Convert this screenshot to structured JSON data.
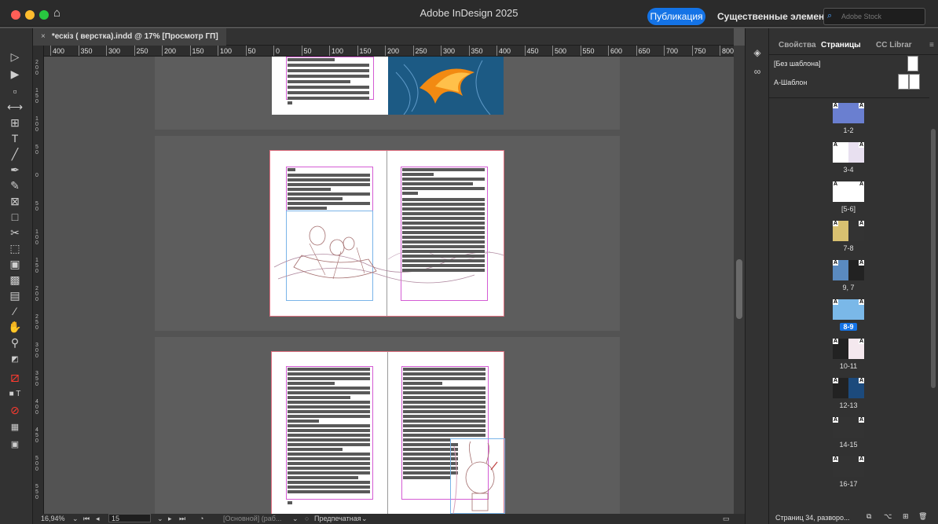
{
  "window": {
    "app_title": "Adobe InDesign 2025"
  },
  "header": {
    "publish_label": "Публикация",
    "workspace_label": "Существенные элементы",
    "stock_placeholder": "Adobe Stock"
  },
  "document_tab": {
    "close_glyph": "×",
    "title": "*ескіз ( верстка).indd @ 17% [Просмотр ГП]"
  },
  "hruler": {
    "labels": [
      "400",
      "350",
      "300",
      "250",
      "200",
      "150",
      "100",
      "50",
      "0",
      "50",
      "100",
      "150",
      "200",
      "250",
      "300",
      "350",
      "400",
      "450",
      "500",
      "550",
      "600",
      "650",
      "700",
      "750",
      "800"
    ]
  },
  "vruler": {
    "labels": [
      "200",
      "150",
      "100",
      "50",
      "0",
      "50",
      "100",
      "150",
      "200",
      "250",
      "300",
      "350",
      "400",
      "450",
      "500",
      "550"
    ]
  },
  "status": {
    "zoom": "16,94%",
    "page_number": "15",
    "master": "[Основной] (раб...",
    "preflight": "Предпечатная"
  },
  "right_panel": {
    "tabs": [
      "Свойства",
      "Страницы",
      "CC Librar"
    ],
    "masters": [
      "[Без шаблона]",
      "А-Шаблон"
    ],
    "master_letter": "А",
    "pages": [
      {
        "label": "1-2",
        "selected": false
      },
      {
        "label": "3-4",
        "selected": false
      },
      {
        "label": "[5-6]",
        "selected": false
      },
      {
        "label": "7-8",
        "selected": false
      },
      {
        "label": "9, 7",
        "selected": false
      },
      {
        "label": "8-9",
        "selected": true
      },
      {
        "label": "10-11",
        "selected": false
      },
      {
        "label": "12-13",
        "selected": false
      },
      {
        "label": "14-15",
        "selected": false
      },
      {
        "label": "16-17",
        "selected": false
      }
    ],
    "footer": "Страниц 34, разворо..."
  },
  "colors": {
    "accent": "#1473e6",
    "margin_guide": "#d45cd4",
    "frame_guide": "#7ab4e8"
  }
}
